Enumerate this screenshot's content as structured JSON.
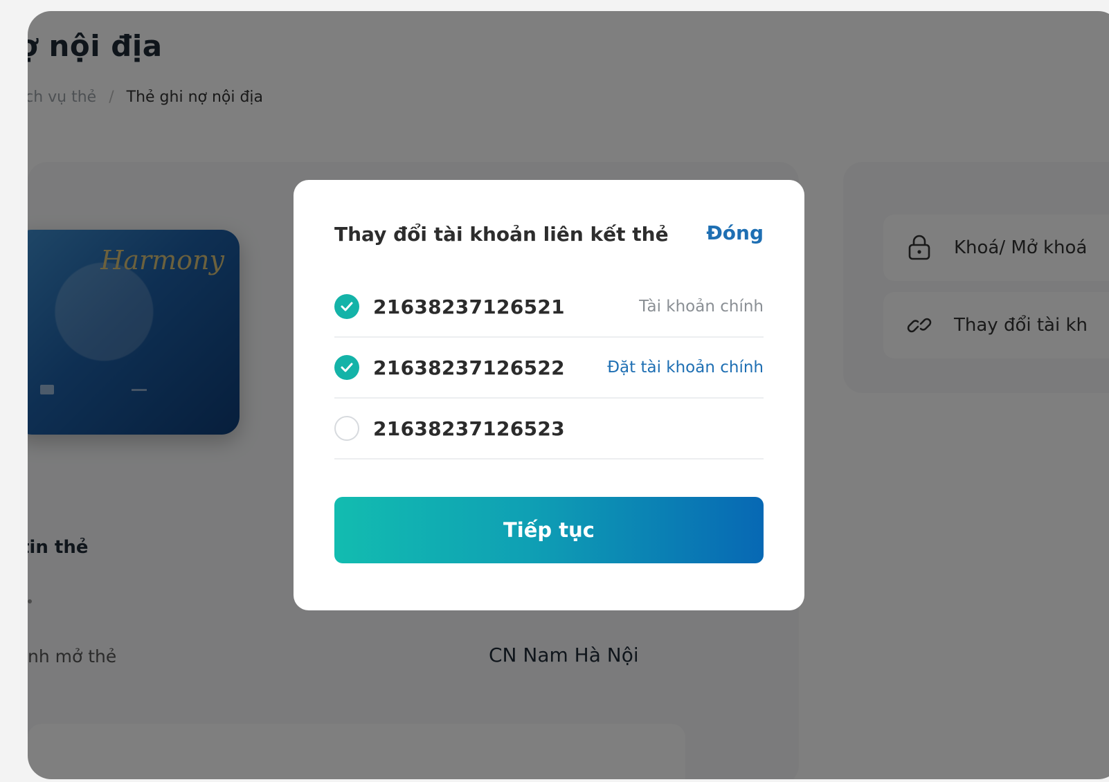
{
  "page": {
    "title": "ợ nội địa",
    "breadcrumb": {
      "previous": "ịch vụ thẻ",
      "separator": "/",
      "current": "Thẻ ghi nợ nội địa"
    }
  },
  "card": {
    "brand": "Harmony"
  },
  "card_info": {
    "section_title": "tin thẻ",
    "branch_label": "nh mở thẻ",
    "branch_value": "CN Nam Hà Nội"
  },
  "actions": [
    {
      "label": "Khoá/ Mở khoá",
      "icon": "lock-icon"
    },
    {
      "label": "Thay đổi tài kh",
      "icon": "link-icon"
    }
  ],
  "modal": {
    "title": "Thay đổi tài khoản liên kết thẻ",
    "close_label": "Đóng",
    "accounts": [
      {
        "number": "21638237126521",
        "checked": true,
        "tag": "Tài khoản chính",
        "tag_type": "primary"
      },
      {
        "number": "21638237126522",
        "checked": true,
        "tag": "Đặt tài khoản chính",
        "tag_type": "action"
      },
      {
        "number": "21638237126523",
        "checked": false,
        "tag": "",
        "tag_type": "none"
      }
    ],
    "continue_label": "Tiếp tục"
  },
  "colors": {
    "accent": "#1e6fb3",
    "check": "#14b3a8",
    "button_start": "#12bcb0",
    "button_end": "#0768b4",
    "overlay": "rgba(0,0,0,0.5)"
  }
}
